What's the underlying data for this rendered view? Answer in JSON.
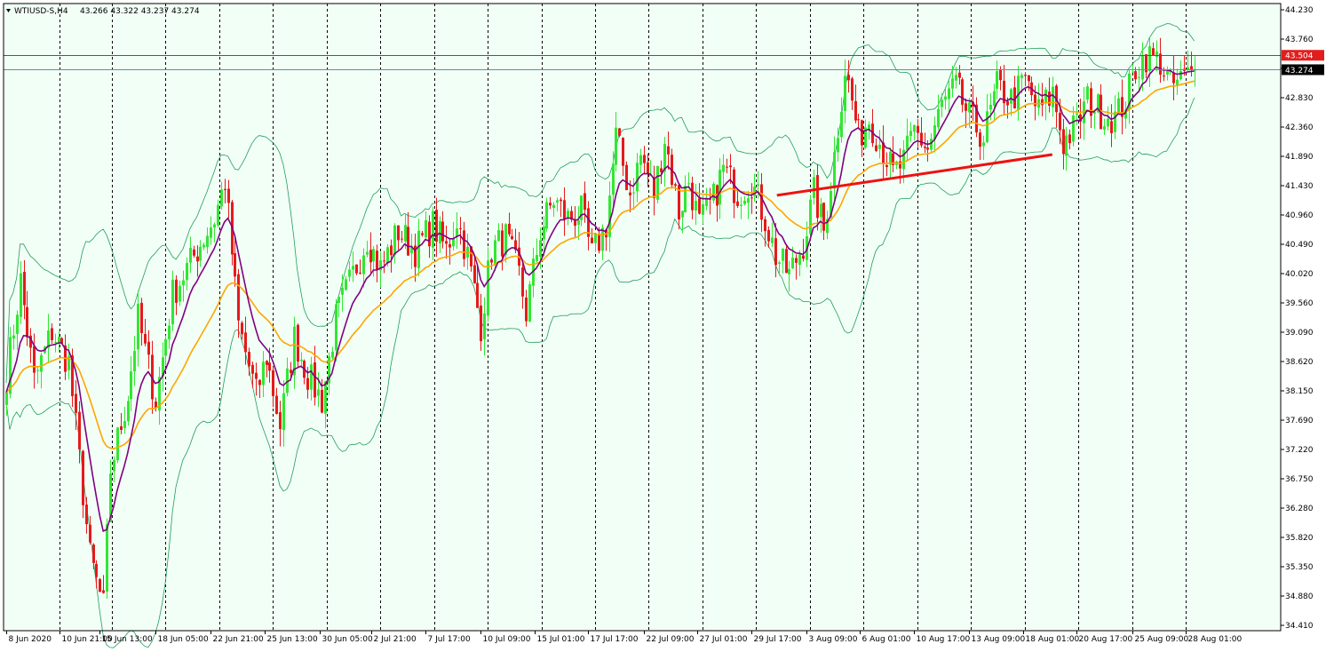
{
  "header": {
    "symbol_tf": "WTIUSD-S,H4",
    "ohlc": "43.266 43.322 43.237 43.274"
  },
  "colors": {
    "background": "#f2fff6",
    "bull": "#33e633",
    "bear": "#e61a1a",
    "ema_fast": "#800080",
    "ema_slow": "#ffa500",
    "bands": "#1f9e5a",
    "grid": "#000000",
    "hline_resistance": "#e21d1d",
    "hline_bid": "#5a8fb0",
    "trendline": "#ee1111"
  },
  "chart_data": {
    "type": "candlestick",
    "title": "WTIUSD-S,H4",
    "ylim": [
      34.41,
      44.23
    ],
    "y_ticks": [
      "44.230",
      "43.760",
      "43.290",
      "42.830",
      "42.360",
      "41.890",
      "41.430",
      "40.960",
      "40.490",
      "40.020",
      "39.560",
      "39.090",
      "38.620",
      "38.150",
      "37.690",
      "37.220",
      "36.750",
      "36.280",
      "35.820",
      "35.350",
      "34.880",
      "34.410"
    ],
    "x_ticks": [
      {
        "label": "8 Jun 2020",
        "index": 0
      },
      {
        "label": "10 Jun 21:00",
        "index": 15.5
      },
      {
        "label": "15 Jun 13:00",
        "index": 27
      },
      {
        "label": "18 Jun 05:00",
        "index": 43
      },
      {
        "label": "22 Jun 21:00",
        "index": 59
      },
      {
        "label": "25 Jun 13:00",
        "index": 74.5
      },
      {
        "label": "30 Jun 05:00",
        "index": 90.5
      },
      {
        "label": "2 Jul 21:00",
        "index": 105.5
      },
      {
        "label": "7 Jul 17:00",
        "index": 121
      },
      {
        "label": "10 Jul 09:00",
        "index": 137
      },
      {
        "label": "15 Jul 01:00",
        "index": 152.5
      },
      {
        "label": "17 Jul 17:00",
        "index": 168
      },
      {
        "label": "22 Jul 09:00",
        "index": 184
      },
      {
        "label": "27 Jul 01:00",
        "index": 199.5
      },
      {
        "label": "29 Jul 17:00",
        "index": 215
      },
      {
        "label": "3 Aug 09:00",
        "index": 231
      },
      {
        "label": "6 Aug 01:00",
        "index": 246.5
      },
      {
        "label": "10 Aug 17:00",
        "index": 262
      },
      {
        "label": "13 Aug 09:00",
        "index": 278
      },
      {
        "label": "18 Aug 01:00",
        "index": 293.5
      },
      {
        "label": "20 Aug 17:00",
        "index": 309
      },
      {
        "label": "25 Aug 09:00",
        "index": 325
      },
      {
        "label": "28 Aug 01:00",
        "index": 340.5
      }
    ],
    "vgrid_indices": [
      15.5,
      30.5,
      46,
      61.5,
      77,
      92.5,
      108,
      123.5,
      139,
      154.5,
      170,
      185.5,
      201,
      216.5,
      232,
      247.5,
      263,
      278.5,
      294,
      309.5,
      325,
      340.5
    ],
    "lines": [
      {
        "name": "resistance",
        "value": 43.504,
        "label": "43.504"
      },
      {
        "name": "bid",
        "value": 43.274,
        "label": "43.274"
      }
    ],
    "trendline": {
      "start": {
        "index": 222.5,
        "price": 41.27
      },
      "end": {
        "index": 302,
        "price": 41.92
      }
    },
    "anchors": [
      [
        0,
        38.4
      ],
      [
        4,
        39.9
      ],
      [
        8,
        38.3
      ],
      [
        13,
        39.1
      ],
      [
        18,
        38.6
      ],
      [
        24,
        35.5
      ],
      [
        28,
        34.7
      ],
      [
        30,
        36.9
      ],
      [
        35,
        38.1
      ],
      [
        38,
        39.3
      ],
      [
        43,
        38.0
      ],
      [
        48,
        39.7
      ],
      [
        53,
        40.2
      ],
      [
        60,
        40.9
      ],
      [
        63,
        41.5
      ],
      [
        67,
        39.2
      ],
      [
        72,
        38.1
      ],
      [
        75,
        38.7
      ],
      [
        79,
        37.6
      ],
      [
        83,
        39.0
      ],
      [
        87,
        38.4
      ],
      [
        91,
        38.0
      ],
      [
        95,
        39.3
      ],
      [
        100,
        40.0
      ],
      [
        104,
        40.6
      ],
      [
        108,
        40.1
      ],
      [
        113,
        40.7
      ],
      [
        118,
        40.4
      ],
      [
        123,
        40.8
      ],
      [
        127,
        40.4
      ],
      [
        130,
        40.9
      ],
      [
        133,
        40.3
      ],
      [
        137,
        39.2
      ],
      [
        140,
        40.4
      ],
      [
        144,
        40.6
      ],
      [
        148,
        40.0
      ],
      [
        150,
        39.4
      ],
      [
        154,
        40.7
      ],
      [
        158,
        41.2
      ],
      [
        162,
        40.9
      ],
      [
        166,
        41.0
      ],
      [
        169,
        40.3
      ],
      [
        173,
        40.8
      ],
      [
        176,
        42.2
      ],
      [
        180,
        41.3
      ],
      [
        183,
        41.9
      ],
      [
        187,
        41.3
      ],
      [
        190,
        42.2
      ],
      [
        194,
        41.0
      ],
      [
        197,
        41.5
      ],
      [
        200,
        40.8
      ],
      [
        204,
        41.2
      ],
      [
        207,
        41.7
      ],
      [
        211,
        41.3
      ],
      [
        215,
        41.5
      ],
      [
        219,
        40.9
      ],
      [
        222,
        40.3
      ],
      [
        226,
        40.0
      ],
      [
        230,
        40.5
      ],
      [
        233,
        41.3
      ],
      [
        236,
        40.7
      ],
      [
        239,
        41.9
      ],
      [
        242,
        43.3
      ],
      [
        246,
        42.2
      ],
      [
        249,
        42.5
      ],
      [
        253,
        42.0
      ],
      [
        256,
        41.6
      ],
      [
        259,
        41.8
      ],
      [
        262,
        42.3
      ],
      [
        266,
        42.0
      ],
      [
        270,
        42.7
      ],
      [
        274,
        43.0
      ],
      [
        278,
        42.5
      ],
      [
        282,
        42.2
      ],
      [
        286,
        43.0
      ],
      [
        290,
        42.8
      ],
      [
        294,
        43.1
      ],
      [
        298,
        42.6
      ],
      [
        302,
        42.9
      ],
      [
        305,
        42.1
      ],
      [
        309,
        42.4
      ],
      [
        312,
        42.8
      ],
      [
        316,
        42.6
      ],
      [
        320,
        42.5
      ],
      [
        323,
        42.8
      ],
      [
        326,
        43.3
      ],
      [
        329,
        43.5
      ],
      [
        333,
        43.4
      ],
      [
        336,
        43.0
      ],
      [
        339,
        43.1
      ],
      [
        343,
        43.27
      ]
    ],
    "candle_count": 344
  },
  "price_axis": {
    "resistance_tag": "43.504",
    "bid_tag": "43.274"
  }
}
